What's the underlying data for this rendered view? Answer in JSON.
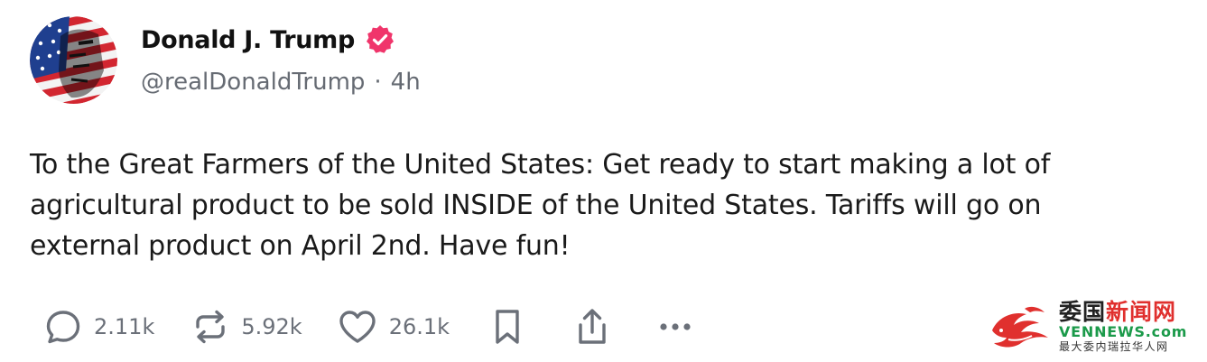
{
  "author": {
    "display_name": "Donald J. Trump",
    "handle": "@realDonaldTrump",
    "separator": "·",
    "time_ago": "4h",
    "verified_badge_icon": "verified-badge-icon",
    "verified_badge_color": "#f0356b"
  },
  "post": {
    "text": "To the Great Farmers of the United States: Get ready to start making a lot of agricultural product to be sold INSIDE of the United States. Tariffs will go on external product on April 2nd. Have fun!"
  },
  "actions": {
    "replies": {
      "icon": "reply-icon",
      "count": "2.11k"
    },
    "reposts": {
      "icon": "repost-icon",
      "count": "5.92k"
    },
    "likes": {
      "icon": "heart-icon",
      "count": "26.1k"
    },
    "bookmark": {
      "icon": "bookmark-icon"
    },
    "share": {
      "icon": "share-icon"
    },
    "more": {
      "icon": "more-icon"
    }
  },
  "watermark": {
    "title_part1": "委国",
    "title_part2": "新闻网",
    "domain": "VENNEWS.com",
    "tagline": "最大委内瑞拉华人网",
    "logo_icon": "dragon-logo-icon"
  },
  "colors": {
    "text": "#1a1a1a",
    "muted": "#666b73",
    "verified": "#f0356b",
    "watermark_red": "#e0302e",
    "watermark_green": "#1b9a4a"
  }
}
